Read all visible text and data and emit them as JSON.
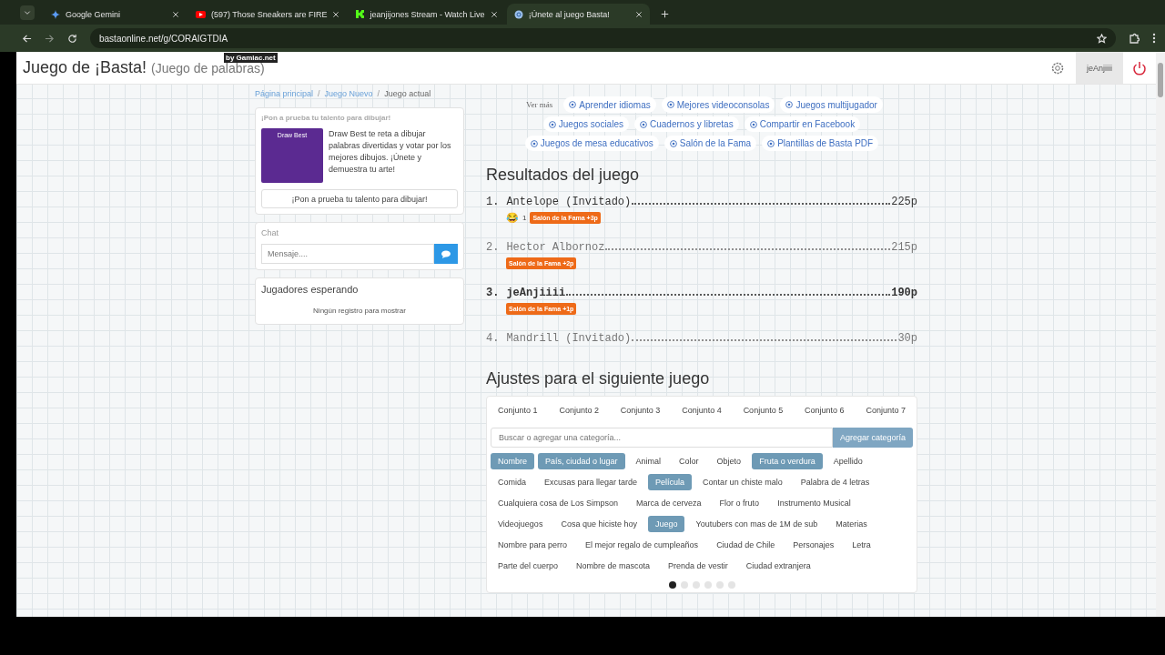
{
  "browser": {
    "tabs": [
      {
        "title": "Google Gemini",
        "selected": false
      },
      {
        "title": "(597) Those Sneakers are FIRE",
        "selected": false
      },
      {
        "title": "jeanjijones Stream - Watch Live",
        "selected": false
      },
      {
        "title": "¡Únete al juego Basta!",
        "selected": true
      }
    ],
    "url": "bastaonline.net/g/CORAIGTDIA"
  },
  "header": {
    "title": "Juego de ¡Basta!",
    "subtitle": "(Juego de palabras)",
    "byline": "by Gamiac.net",
    "user": "jeAnjiiii"
  },
  "breadcrumb_separator": "/",
  "breadcrumb": [
    {
      "label": "Página principal",
      "kind": "link"
    },
    {
      "label": "Juego Nuevo",
      "kind": "link"
    },
    {
      "label": "Juego actual",
      "kind": "current"
    }
  ],
  "promo": {
    "heading": "¡Pon a prueba tu talento para dibujar!",
    "image_title": "Draw Best",
    "text": "Draw Best te reta a dibujar palabras divertidas y votar por los mejores dibujos. ¡Únete y demuestra tu arte!",
    "button": "¡Pon a prueba tu talento para dibujar!"
  },
  "chat": {
    "heading": "Chat",
    "placeholder": "Mensaje...."
  },
  "waiting": {
    "heading": "Jugadores esperando",
    "empty": "Ningún registro para mostrar"
  },
  "more": {
    "label": "Ver más",
    "links": [
      "Aprender idiomas",
      "Mejores videoconsolas",
      "Juegos multijugador",
      "Juegos sociales",
      "Cuadernos y libretas",
      "Compartir en Facebook",
      "Juegos de mesa educativos",
      "Salón de la Fama",
      "Plantillas de Basta PDF"
    ]
  },
  "results": {
    "heading": "Resultados del juego",
    "rows": [
      {
        "rank": "1.",
        "name": "Antelope (Invitado)",
        "points": "225p",
        "kind": "dark",
        "reaction": "😂",
        "reaction_count": "1",
        "badge": "Salón de la Fama +3p"
      },
      {
        "rank": "2.",
        "name": "Hector Albornoz",
        "points": "215p",
        "kind": "muted",
        "badge": "Salón de la Fama +2p"
      },
      {
        "rank": "3.",
        "name": "jeAnjiiii",
        "points": "190p",
        "kind": "bold",
        "badge": "Salón de la Fama +1p"
      },
      {
        "rank": "4.",
        "name": "Mandrill (Invitado)",
        "points": "30p",
        "kind": "muted"
      }
    ]
  },
  "settings": {
    "heading": "Ajustes para el siguiente juego",
    "tabs": [
      {
        "label": "Conjunto 1",
        "selected": false
      },
      {
        "label": "Conjunto 2",
        "selected": false
      },
      {
        "label": "Conjunto 3",
        "selected": false
      },
      {
        "label": "Conjunto 4",
        "selected": false
      },
      {
        "label": "Conjunto 5",
        "selected": false
      },
      {
        "label": "Conjunto 6",
        "selected": false
      },
      {
        "label": "Conjunto 7",
        "selected": false
      }
    ],
    "search_placeholder": "Buscar o agregar una categoría...",
    "add_button": "Agregar categoría",
    "categories": [
      {
        "label": "Nombre",
        "selected": true
      },
      {
        "label": "País, ciudad o lugar",
        "selected": true
      },
      {
        "label": "Animal",
        "selected": false
      },
      {
        "label": "Color",
        "selected": false
      },
      {
        "label": "Objeto",
        "selected": false
      },
      {
        "label": "Fruta o verdura",
        "selected": true
      },
      {
        "label": "Apellido",
        "selected": false
      },
      {
        "label": "Comida",
        "selected": false
      },
      {
        "label": "Excusas para llegar tarde",
        "selected": false
      },
      {
        "label": "Película",
        "selected": true
      },
      {
        "label": "Contar un chiste malo",
        "selected": false
      },
      {
        "label": "Palabra de 4 letras",
        "selected": false
      },
      {
        "label": "Cualquiera cosa de Los Simpson",
        "selected": false
      },
      {
        "label": "Marca de cerveza",
        "selected": false
      },
      {
        "label": "Flor o fruto",
        "selected": false
      },
      {
        "label": "Instrumento Musical",
        "selected": false
      },
      {
        "label": "Videojuegos",
        "selected": false
      },
      {
        "label": "Cosa que hiciste hoy",
        "selected": false
      },
      {
        "label": "Juego",
        "selected": true
      },
      {
        "label": "Youtubers con mas de 1M de sub",
        "selected": false
      },
      {
        "label": "Materias",
        "selected": false
      },
      {
        "label": "Nombre para perro",
        "selected": false
      },
      {
        "label": "El mejor regalo de cumpleaños",
        "selected": false
      },
      {
        "label": "Ciudad de Chile",
        "selected": false
      },
      {
        "label": "Personajes",
        "selected": false
      },
      {
        "label": "Letra",
        "selected": false
      },
      {
        "label": "Parte del cuerpo",
        "selected": false
      },
      {
        "label": "Nombre de mascota",
        "selected": false
      },
      {
        "label": "Prenda de vestir",
        "selected": false
      },
      {
        "label": "Ciudad extranjera",
        "selected": false
      }
    ],
    "pager": [
      {
        "selected": true
      },
      {
        "selected": false
      },
      {
        "selected": false
      },
      {
        "selected": false
      },
      {
        "selected": false
      },
      {
        "selected": false
      }
    ]
  }
}
